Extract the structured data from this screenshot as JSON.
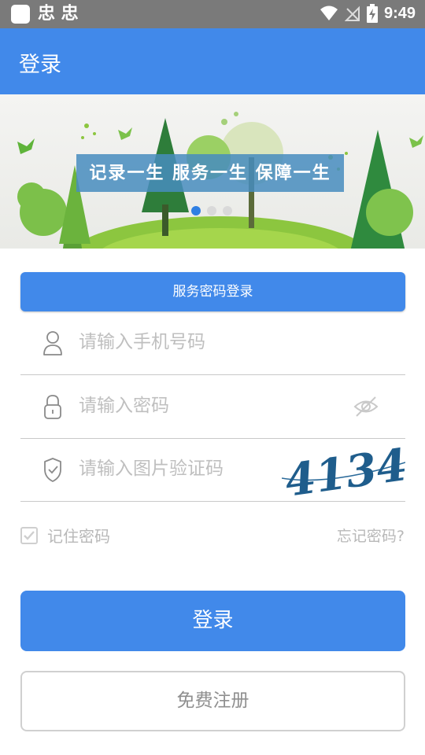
{
  "status_bar": {
    "app_glyphs": "忠 忠",
    "time": "9:49"
  },
  "app_bar": {
    "title": "登录"
  },
  "banner": {
    "caption": "记录一生 服务一生 保障一生",
    "slides_total": 3,
    "active_slide": 1
  },
  "login_tab": {
    "label": "服务密码登录"
  },
  "form": {
    "phone": {
      "placeholder": "请输入手机号码",
      "icon": "user-icon"
    },
    "password": {
      "placeholder": "请输入密码",
      "icon": "lock-icon",
      "toggle_icon": "eye-off-icon"
    },
    "captcha": {
      "placeholder": "请输入图片验证码",
      "icon": "shield-check-icon",
      "image_text": "4134"
    }
  },
  "remember": {
    "label": "记住密码",
    "checked": true
  },
  "forgot_label": "忘记密码?",
  "login_button": "登录",
  "register_button": "免费注册",
  "colors": {
    "primary": "#4189ea",
    "status_bar": "#7a7a7a",
    "placeholder": "#bfbfbf",
    "captcha_ink": "#1f5d8c"
  }
}
